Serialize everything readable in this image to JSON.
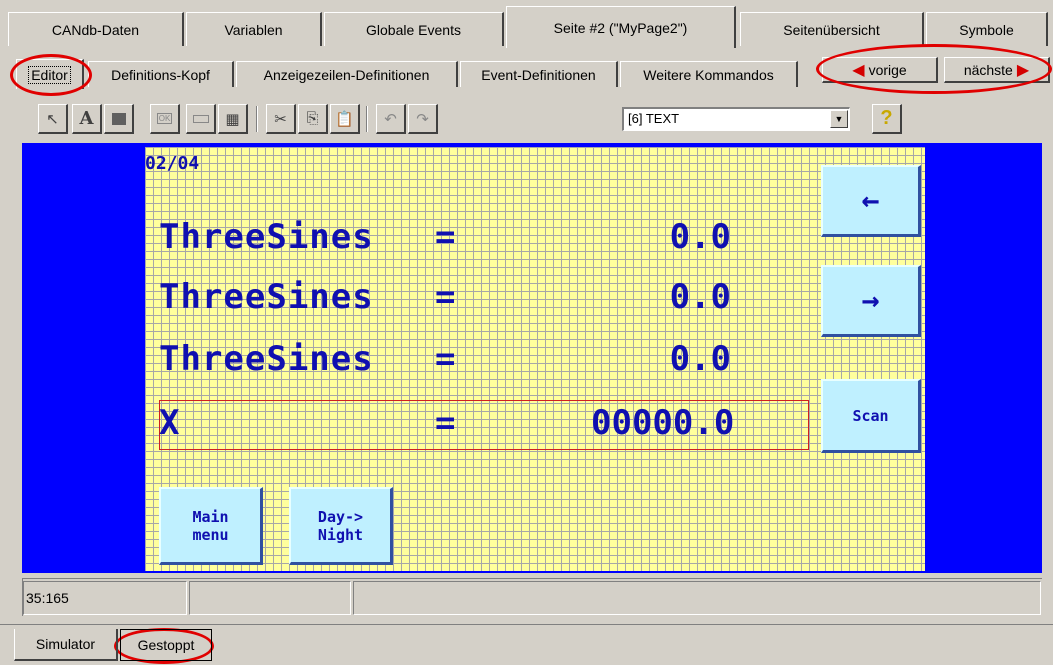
{
  "top_tabs": [
    {
      "label": "CANdb-Daten"
    },
    {
      "label": "Variablen"
    },
    {
      "label": "Globale Events"
    },
    {
      "label": "Seite #2 (\"MyPage2\")"
    },
    {
      "label": "Seitenübersicht"
    },
    {
      "label": "Symbole"
    }
  ],
  "sub_tabs": [
    {
      "label": "Editor"
    },
    {
      "label": "Definitions-Kopf"
    },
    {
      "label": "Anzeigezeilen-Definitionen"
    },
    {
      "label": "Event-Definitionen"
    },
    {
      "label": "Weitere Kommandos"
    }
  ],
  "nav": {
    "prev_label": "vorige",
    "next_label": "nächste"
  },
  "toolbar": {
    "icons": [
      "pointer-icon",
      "text-icon",
      "image-icon",
      "ok-button-icon",
      "input-field-icon",
      "grid-icon",
      "cut-icon",
      "copy-icon",
      "paste-icon",
      "undo-icon",
      "redo-icon",
      "help-icon"
    ],
    "item_select_value": "[6] TEXT"
  },
  "lcd": {
    "page_indicator": "02/04",
    "rows": [
      {
        "label": "ThreeSines",
        "eq": "=",
        "value": "0.0"
      },
      {
        "label": "ThreeSines",
        "eq": "=",
        "value": "0.0"
      },
      {
        "label": "ThreeSines",
        "eq": "=",
        "value": "0.0"
      },
      {
        "label": "X",
        "eq": "=",
        "value": "00000.0"
      }
    ],
    "buttons": {
      "back_arrow": "←",
      "forward_arrow": "→",
      "scan": "Scan",
      "main_menu_line1": "Main",
      "main_menu_line2": "menu",
      "day_night_line1": "Day->",
      "day_night_line2": "Night"
    }
  },
  "status": {
    "cursor_pos": "35:165",
    "cell2": "",
    "cell3": ""
  },
  "bottom": {
    "simulator_label": "Simulator",
    "state_label": "Gestoppt"
  },
  "colors": {
    "canvas_bg": "#0000ff",
    "lcd_bg": "#ffff9c",
    "lcd_text": "#1010b0",
    "annotation": "#e00000"
  }
}
